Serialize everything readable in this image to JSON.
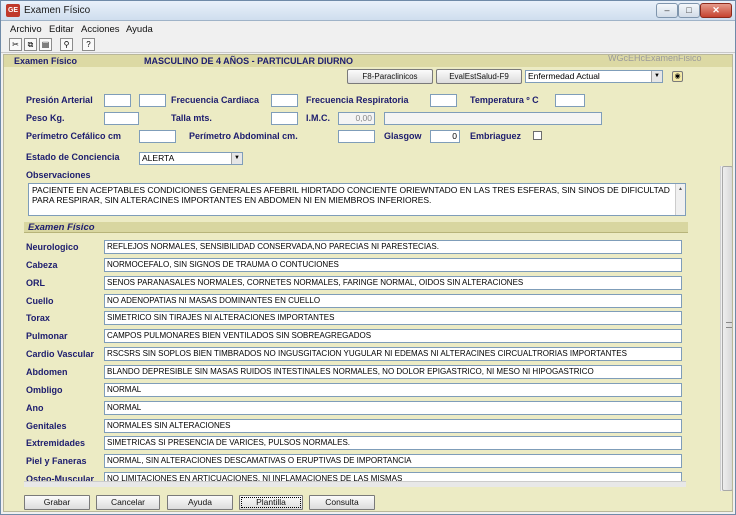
{
  "window": {
    "title": "Examen Físico"
  },
  "menu": [
    "Archivo",
    "Editar",
    "Acciones",
    "Ayuda"
  ],
  "toolbar_icons": [
    "scissors-icon",
    "copy-icon",
    "paste-icon",
    "broom-icon",
    "help-icon"
  ],
  "header": {
    "title": "Examen Físico",
    "patient": "MASCULINO DE 4 AÑOS - PARTICULAR DIURNO",
    "form_id": "WGcEHcExamenFisico"
  },
  "top_buttons": {
    "paraclinicos": "F8-Paraclinicos",
    "evalestsalud": "EvalEstSalud-F9"
  },
  "selects": {
    "enfermedad_actual": "Enfermedad Actual",
    "estado_conciencia": "ALERTA"
  },
  "vitals": {
    "presion_arterial": "Presión Arterial",
    "frecuencia_cardiaca": "Frecuencia Cardiaca",
    "frecuencia_respiratoria": "Frecuencia Respiratoria",
    "temperatura": "Temperatura º C",
    "peso": "Peso Kg.",
    "talla": "Talla mts.",
    "imc": "I.M.C.",
    "imc_value": "0,00",
    "perimetro_cefalico": "Perímetro Cefálico cm",
    "perimetro_abdominal": "Perímetro Abdominal cm.",
    "glasgow": "Glasgow",
    "glasgow_value": "0",
    "embriaguez": "Embriaguez",
    "estado_conciencia": "Estado de Conciencia",
    "observaciones": "Observaciones"
  },
  "observaciones_text": "PACIENTE EN ACEPTABLES CONDICIONES GENERALES AFEBRIL HIDRTADO CONCIENTE ORIEWNTADO EN LAS TRES ESFERAS, SIN SINOS DE DIFICULTAD PARA RESPIRAR, SIN ALTERACINES IMPORTANTES EN ABDOMEN   NI EN MIEMBROS INFERIORES.",
  "exam_section_title": "Examen Físico",
  "exam": [
    {
      "label": "Neurologico",
      "value": "REFLEJOS NORMALES, SENSIBILIDAD CONSERVADA,NO PARECIAS NI PARESTECIAS."
    },
    {
      "label": "Cabeza",
      "value": "NORMOCEFALO, SIN SIGNOS DE TRAUMA O CONTUCIONES"
    },
    {
      "label": "ORL",
      "value": "SENOS PARANASALES NORMALES, CORNETES NORMALES, FARINGE NORMAL, OIDOS SIN ALTERACIONES"
    },
    {
      "label": "Cuello",
      "value": "NO ADENOPATIAS NI MASAS DOMINANTES EN CUELLO"
    },
    {
      "label": "Torax",
      "value": "SIMETRICO SIN TIRAJES NI ALTERACIONES IMPORTANTES"
    },
    {
      "label": "Pulmonar",
      "value": "CAMPOS PULMONARES BIEN VENTILADOS SIN SOBREAGREGADOS"
    },
    {
      "label": "Cardio Vascular",
      "value": "RSCSRS SIN SOPLOS  BIEN TIMBRADOS NO INGUSGITACION YUGULAR  NI EDEMAS NI ALTERACINES CIRCUALTRORIAS IMPORTANTES"
    },
    {
      "label": "Abdomen",
      "value": "BLANDO DEPRESIBLE SIN MASAS RUIDOS INTESTINALES NORMALES, NO DOLOR EPIGASTRICO, NI MESO NI HIPOGASTRICO"
    },
    {
      "label": "Ombligo",
      "value": "NORMAL"
    },
    {
      "label": "Ano",
      "value": "NORMAL"
    },
    {
      "label": "Genitales",
      "value": "NORMALES SIN ALTERACIONES"
    },
    {
      "label": "Extremidades",
      "value": "SIMETRICAS SI PRESENCIA DE VARICES, PULSOS NORMALES."
    },
    {
      "label": "Piel y Faneras",
      "value": "NORMAL, SIN ALTERACIONES DESCAMATIVAS O ERUPTIVAS DE IMPORTANCIA"
    },
    {
      "label": "Osteo-Muscular",
      "value": "NO LIMITACIONES EN ARTICUACIONES, NI INFLAMACIONES DE LAS MISMAS"
    }
  ],
  "bottom_buttons": {
    "grabar": "Grabar",
    "cancelar": "Cancelar",
    "ayuda": "Ayuda",
    "plantilla": "Plantilla",
    "consulta": "Consulta"
  }
}
